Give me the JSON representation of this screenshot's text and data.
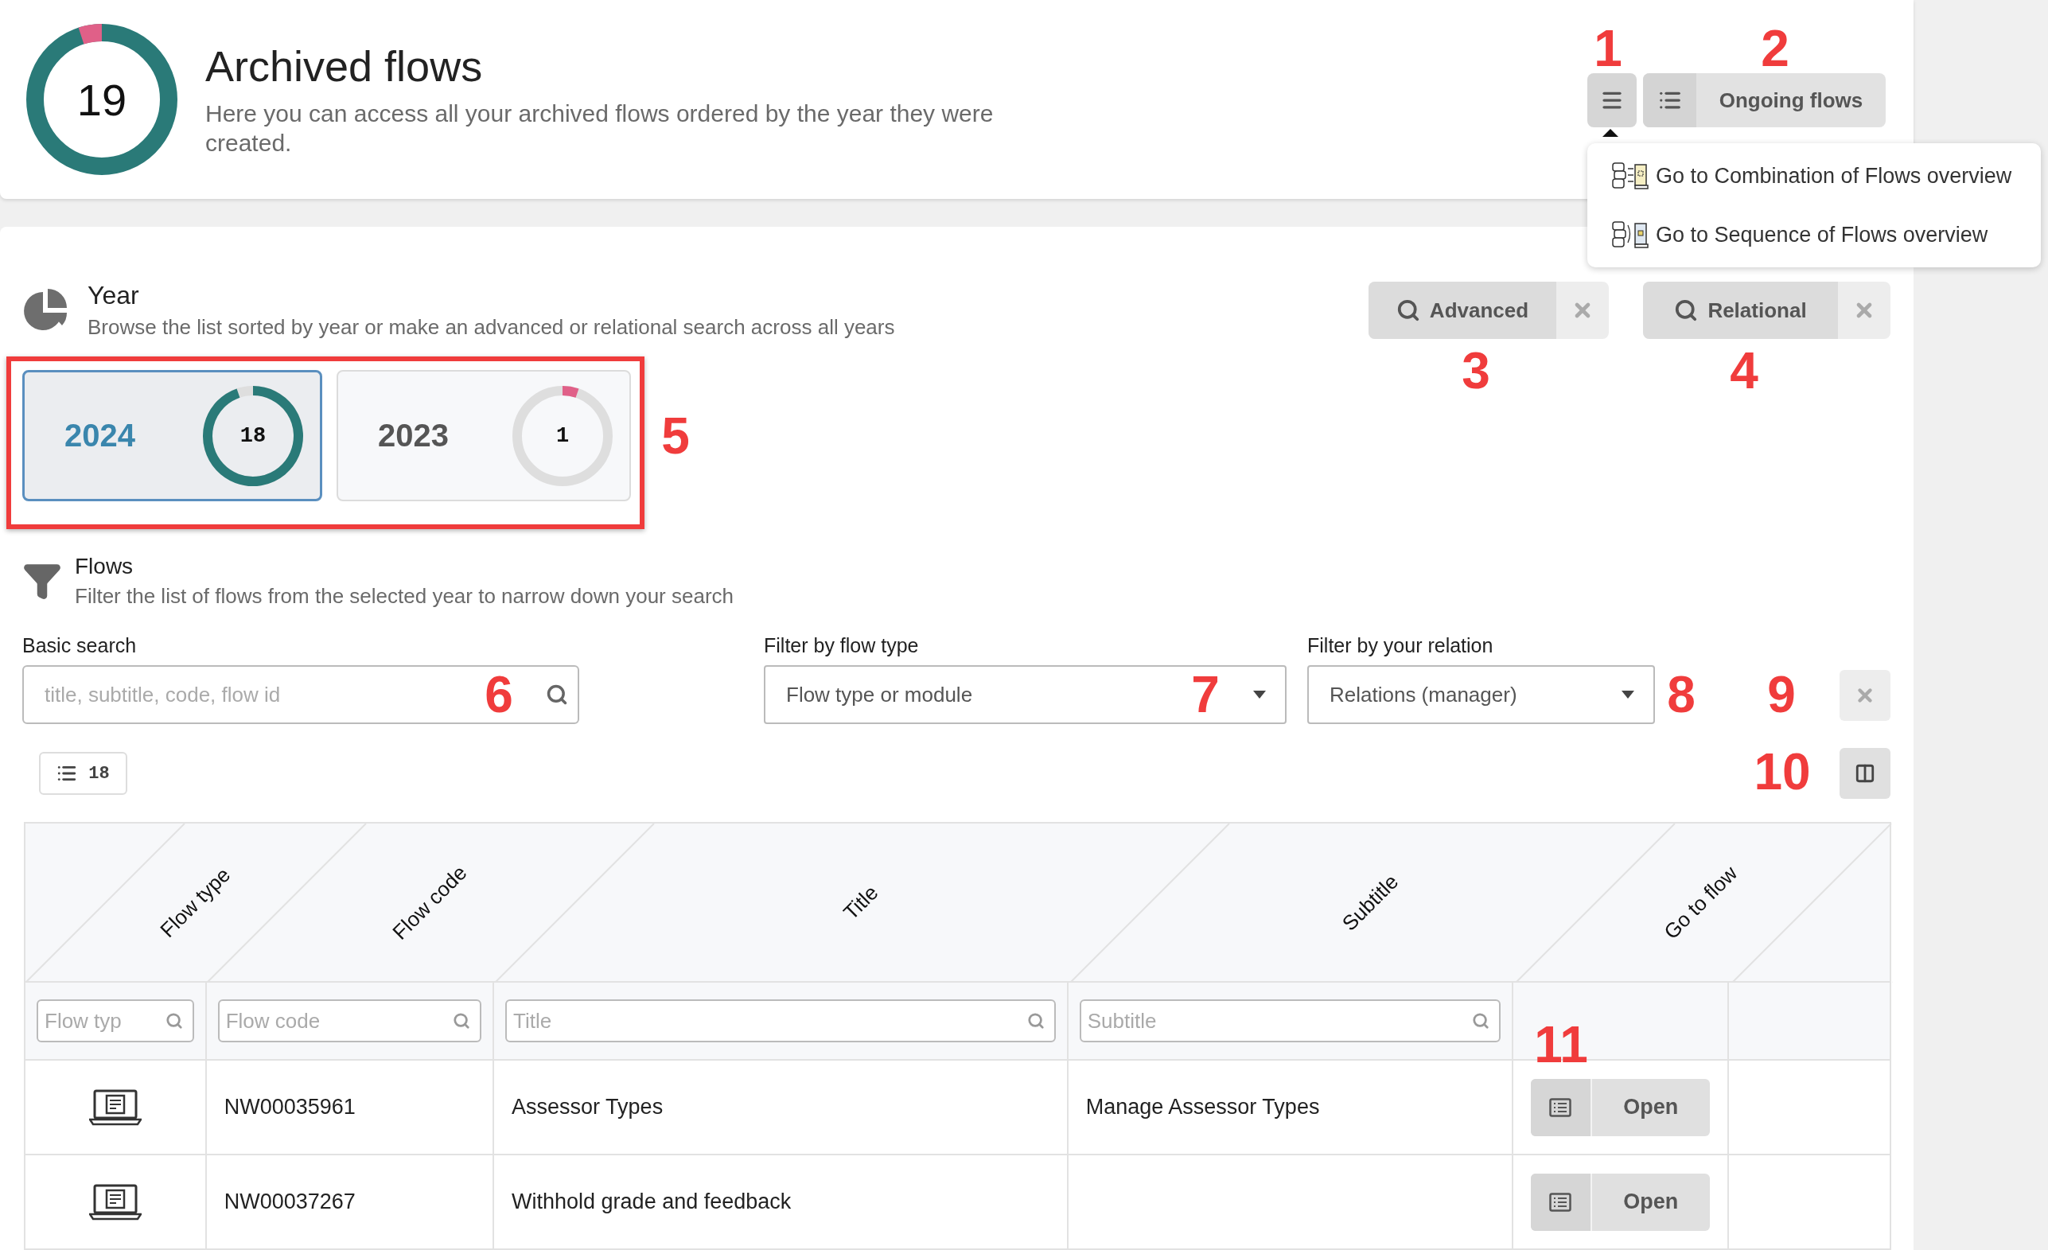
{
  "header": {
    "count": "19",
    "title": "Archived flows",
    "subtitle": "Here you can access all your archived flows ordered by the year they were created."
  },
  "header_buttons": {
    "menu_expanded": true,
    "ongoing_label": "Ongoing flows"
  },
  "menu": [
    {
      "label": "Go to Combination of Flows overview",
      "kind": "combination"
    },
    {
      "label": "Go to Sequence of Flows overview",
      "kind": "sequence"
    }
  ],
  "year_section": {
    "title": "Year",
    "subtitle": "Browse the list sorted by year or make an advanced or relational search across all years"
  },
  "search_buttons": [
    {
      "label": "Advanced"
    },
    {
      "label": "Relational"
    }
  ],
  "years": [
    {
      "year": "2024",
      "count": "18",
      "selected": true,
      "color": "#2a7a78"
    },
    {
      "year": "2023",
      "count": "1",
      "selected": false,
      "color": "#e06088"
    }
  ],
  "flows_section": {
    "title": "Flows",
    "subtitle": "Filter the list of flows from the selected year to narrow down your search"
  },
  "filters": {
    "basic_search": {
      "label": "Basic search",
      "placeholder": "title, subtitle, code, flow id"
    },
    "flow_type": {
      "label": "Filter by flow type",
      "placeholder": "Flow type or module"
    },
    "relation": {
      "label": "Filter by your relation",
      "placeholder": "Relations (manager)"
    }
  },
  "result_count": "18",
  "table": {
    "columns": [
      "Flow type",
      "Flow code",
      "Title",
      "Subtitle",
      "Go to flow"
    ],
    "filter_placeholders": [
      "Flow typ",
      "Flow code",
      "Title",
      "Subtitle"
    ],
    "rows": [
      {
        "flow_code": "NW00035961",
        "title": "Assessor Types",
        "subtitle": "Manage Assessor Types",
        "action": "Open"
      },
      {
        "flow_code": "NW00037267",
        "title": "Withhold grade and feedback",
        "action": "Open"
      }
    ]
  },
  "annotations": [
    {
      "kind": "number",
      "label": "1"
    },
    {
      "kind": "number",
      "label": "2"
    },
    {
      "kind": "number",
      "label": "3"
    },
    {
      "kind": "number",
      "label": "4"
    },
    {
      "kind": "number",
      "label": "5"
    },
    {
      "kind": "number",
      "label": "6"
    },
    {
      "kind": "number",
      "label": "7"
    },
    {
      "kind": "number",
      "label": "8"
    },
    {
      "kind": "number",
      "label": "9"
    },
    {
      "kind": "number",
      "label": "10"
    },
    {
      "kind": "number",
      "label": "11"
    },
    {
      "kind": "box"
    }
  ]
}
